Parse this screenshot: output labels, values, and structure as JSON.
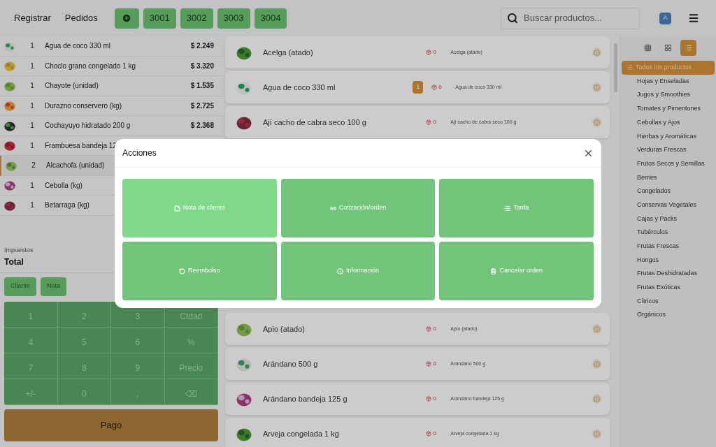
{
  "top_bar": {
    "nav": [
      {
        "label": "Registrar"
      },
      {
        "label": "Pedidos"
      }
    ],
    "order_tabs": [
      {
        "label": "3001",
        "selected": false
      },
      {
        "label": "3002",
        "selected": false
      },
      {
        "label": "3003",
        "selected": false
      },
      {
        "label": "3004",
        "selected": false
      }
    ],
    "search": {
      "placeholder": "Buscar productos..."
    },
    "avatar": "A"
  },
  "order_lines": [
    {
      "qty": "1",
      "name": "Agua de coco 330 ml",
      "price": "$ 2.249",
      "selected": false
    },
    {
      "qty": "1",
      "name": "Choclo grano congelado 1 kg",
      "price": "$ 3.320",
      "selected": false
    },
    {
      "qty": "1",
      "name": "Chayote (unidad)",
      "price": "$ 1.535",
      "selected": false
    },
    {
      "qty": "1",
      "name": "Durazno conservero (kg)",
      "price": "$ 2.725",
      "selected": false
    },
    {
      "qty": "1",
      "name": "Cochayuyo hidratado 200 g",
      "price": "$ 2.368",
      "selected": false
    },
    {
      "qty": "1",
      "name": "Frambuesa bandeja 12",
      "selected": false
    },
    {
      "qty": "2",
      "name": "Alcachofa (unidad)",
      "selected": true
    },
    {
      "qty": "1",
      "name": "Cebolla (kg)",
      "selected": false
    },
    {
      "qty": "1",
      "name": "Betarraga (kg)",
      "selected": false
    }
  ],
  "summary": {
    "taxes_label": "Impuestos",
    "total_label": "Total"
  },
  "order_buttons": [
    "Cliente",
    "Nota"
  ],
  "keypad": [
    "1",
    "2",
    "3",
    "Ctdad",
    "4",
    "5",
    "6",
    "%",
    "7",
    "8",
    "9",
    "Precio",
    "+/-",
    "0",
    ",",
    "⌫"
  ],
  "pay_button": "Pago",
  "products_top": [
    {
      "name": "Acelga (atado)",
      "stock": "0",
      "note": "Acelga (atado)"
    },
    {
      "name": "Agua de coco 330 ml",
      "in_cart": "1",
      "stock": "0",
      "note": "Agua de coco 330 ml"
    },
    {
      "name": "Ají cacho de cabra seco 100 g",
      "stock": "0",
      "note": "Ají cacho de cabra seco 100 g"
    }
  ],
  "products_bottom": [
    {
      "name": "Apio (atado)",
      "stock": "0",
      "note": "Apio (atado)"
    },
    {
      "name": "Arándano 500 g",
      "stock": "0",
      "note": "Arándano 500 g"
    },
    {
      "name": "Arándano bandeja 125 g",
      "stock": "0",
      "note": "Arándano bandeja 125 g"
    },
    {
      "name": "Arveja congelada 1 kg",
      "stock": "0",
      "note": "Arveja congelada 1 kg"
    }
  ],
  "view_modes": [
    {
      "kind": "small-grid",
      "selected": false
    },
    {
      "kind": "large-grid",
      "selected": false
    },
    {
      "kind": "list",
      "selected": true
    }
  ],
  "categories": [
    {
      "label": "Todos los productos",
      "selected": true
    },
    {
      "label": "Hojas y Enseladas",
      "selected": false
    },
    {
      "label": "Jugos y Smoothies",
      "selected": false
    },
    {
      "label": "Tomates y Pimentones",
      "selected": false
    },
    {
      "label": "Cebollas y Ajos",
      "selected": false
    },
    {
      "label": "Hierbas y Aromáticas",
      "selected": false
    },
    {
      "label": "Verduras Frescas",
      "selected": false
    },
    {
      "label": "Frutos Secos y Semillas",
      "selected": false
    },
    {
      "label": "Berries",
      "selected": false
    },
    {
      "label": "Congelados",
      "selected": false
    },
    {
      "label": "Conservas Vegetales",
      "selected": false
    },
    {
      "label": "Cajas y Packs",
      "selected": false
    },
    {
      "label": "Tubérculos",
      "selected": false
    },
    {
      "label": "Frutas Frescas",
      "selected": false
    },
    {
      "label": "Hongos",
      "selected": false
    },
    {
      "label": "Frutas Deshidratadas",
      "selected": false
    },
    {
      "label": "Frutas Exóticas",
      "selected": false
    },
    {
      "label": "Cítricos",
      "selected": false
    },
    {
      "label": "Orgánicos",
      "selected": false
    }
  ],
  "dialog": {
    "title": "Acciones",
    "actions": [
      {
        "kind": "note",
        "label": "Nota de cliente",
        "selected": true
      },
      {
        "kind": "link",
        "label": "Cotización/orden",
        "selected": false
      },
      {
        "kind": "list",
        "label": "Tarifa",
        "selected": false
      },
      {
        "kind": "refund",
        "label": "Reembolso",
        "selected": false
      },
      {
        "kind": "info",
        "label": "Información",
        "selected": false
      },
      {
        "kind": "trash",
        "label": "Cancelar orden",
        "selected": false
      }
    ]
  }
}
